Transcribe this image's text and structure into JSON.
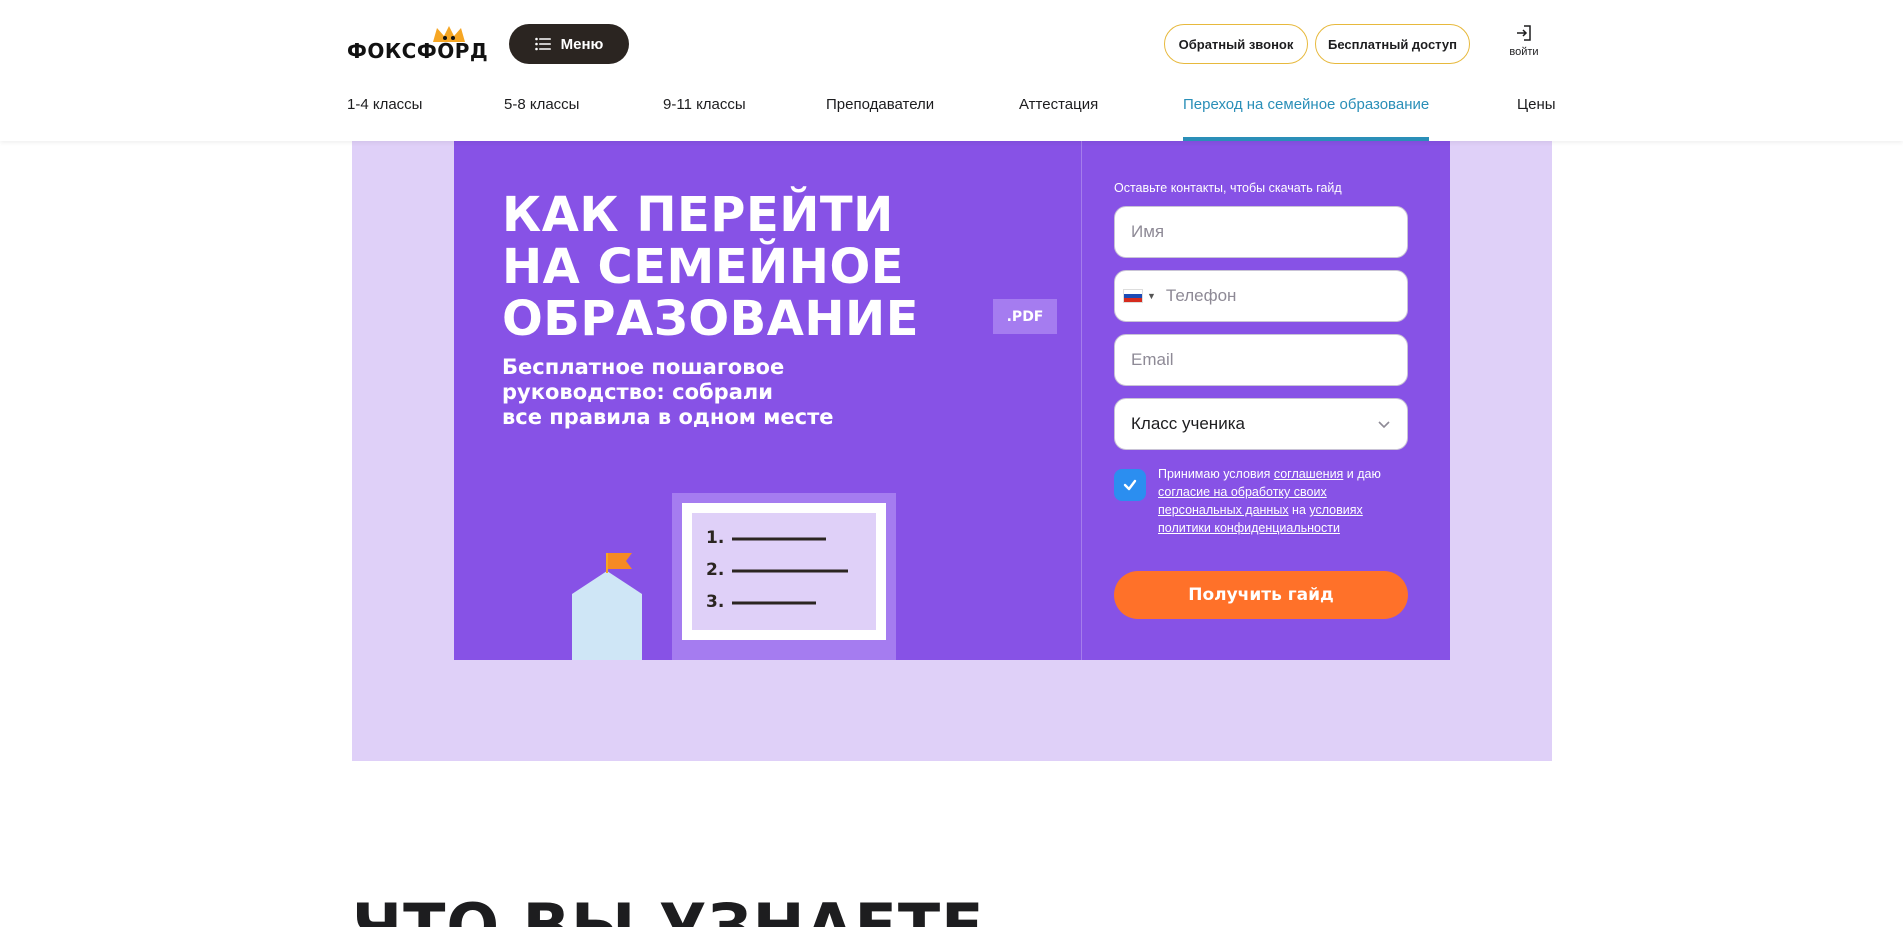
{
  "header": {
    "logo_text": "ФОКСФОРД",
    "menu_label": "Меню",
    "callback_label": "Обратный звонок",
    "free_access_label": "Бесплатный доступ",
    "login_label": "войти"
  },
  "nav": {
    "items": [
      {
        "label": "1-4 классы"
      },
      {
        "label": "5-8 классы"
      },
      {
        "label": "9-11 классы"
      },
      {
        "label": "Преподаватели"
      },
      {
        "label": "Аттестация"
      },
      {
        "label": "Переход на семейное образование",
        "active": true
      },
      {
        "label": "Цены"
      }
    ]
  },
  "banner": {
    "title_line1": "КАК ПЕРЕЙТИ",
    "title_line2": "НА СЕМЕЙНОЕ",
    "title_line3": "ОБРАЗОВАНИЕ",
    "pdf_badge": ".PDF",
    "subtitle_line1": "Бесплатное пошаговое",
    "subtitle_line2": "руководство: собрали",
    "subtitle_line3": "все правила в одном месте",
    "list_numbers": [
      "1.",
      "2.",
      "3."
    ]
  },
  "form": {
    "caption": "Оставьте контакты, чтобы скачать гайд",
    "name_placeholder": "Имя",
    "phone_placeholder": "Телефон",
    "email_placeholder": "Email",
    "class_select_value": "Класс ученика",
    "consent": {
      "checked": true,
      "text_1": "Принимаю условия ",
      "link_1": "соглашения",
      "text_2": " и даю ",
      "link_2": "согласие на обработку своих персональных данных",
      "text_3": " на ",
      "link_3": "условиях политики конфиденциальности"
    },
    "submit_label": "Получить гайд"
  },
  "section": {
    "title": "ЧТО ВЫ УЗНАЕТЕ"
  },
  "colors": {
    "banner_purple": "#8752e6",
    "banner_bg_lilac": "#dfd0f8",
    "accent_orange": "#ff7129",
    "nav_active_blue": "#2a8fb8",
    "checkbox_blue": "#2b8ef0",
    "menu_btn_dark": "#2b2521",
    "outline_gold": "#e7b93d"
  }
}
